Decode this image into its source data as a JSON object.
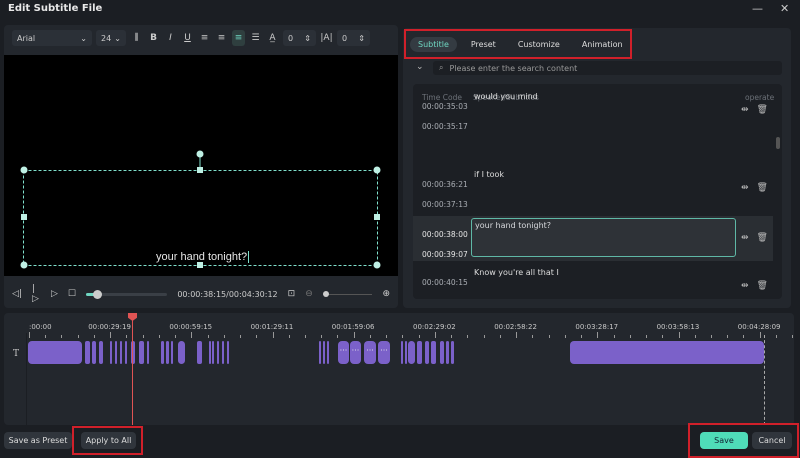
{
  "window": {
    "title": "Edit Subtitle File",
    "minimize_icon": "minimize-icon",
    "close_icon": "close-icon"
  },
  "toolbar": {
    "font": "Arial",
    "size": "24",
    "spacing_value": "0",
    "char_spacing_value": "0"
  },
  "preview": {
    "subtitle_text": "your hand tonight?"
  },
  "playback": {
    "timecode": "00:00:38:15/00:04:30:12",
    "progress": 0.14
  },
  "tabs": [
    {
      "label": "Subtitle",
      "active": true
    },
    {
      "label": "Preset"
    },
    {
      "label": "Customize"
    },
    {
      "label": "Animation"
    }
  ],
  "search": {
    "placeholder": "Please enter the search content"
  },
  "list": {
    "headers": {
      "time": "Time Code",
      "speaker": "Speaker/Subtitles",
      "operate": "operate"
    },
    "rows": [
      {
        "start": "00:00:35:03",
        "end": "00:00:35:17",
        "text": "would you mind"
      },
      {
        "start": "00:00:36:21",
        "end": "00:00:37:13",
        "text": "if I took"
      },
      {
        "start": "00:00:38:00",
        "end": "00:00:39:07",
        "text": "your hand tonight?",
        "active": true
      },
      {
        "start": "00:00:40:15",
        "end": "00:00:42:13",
        "text": "Know you're all that I"
      }
    ]
  },
  "timeline": {
    "ruler": [
      ":00:00",
      "00:00:29:19",
      "00:00:59:15",
      "00:01:29:11",
      "00:01:59:06",
      "00:02:29:02",
      "00:02:58:22",
      "00:03:28:17",
      "00:03:58:13",
      "00:04:28:09"
    ],
    "track_icon": "T",
    "playhead_time": "00:00:38:15"
  },
  "footer": {
    "save_preset": "Save as Preset",
    "apply_all": "Apply to All",
    "save": "Save",
    "cancel": "Cancel",
    "watermark": "wlvid.com"
  },
  "colors": {
    "accent": "#6fd6c1",
    "clip": "#7b61c9",
    "playhead": "#e05454",
    "save": "#4fdcb8",
    "highlight": "#d0202a"
  }
}
